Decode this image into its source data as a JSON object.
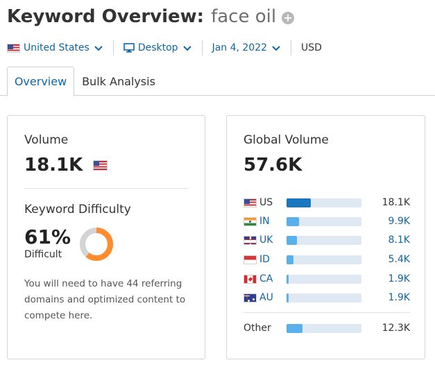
{
  "header": {
    "title": "Keyword Overview:",
    "keyword": "face oil"
  },
  "filters": {
    "country": "United States",
    "device": "Desktop",
    "date": "Jan 4, 2022",
    "currency": "USD"
  },
  "tabs": [
    {
      "label": "Overview",
      "active": true
    },
    {
      "label": "Bulk Analysis",
      "active": false
    }
  ],
  "volume": {
    "label": "Volume",
    "value": "18.1K"
  },
  "difficulty": {
    "label": "Keyword Difficulty",
    "percent": "61%",
    "percent_value": 61,
    "level": "Difficult",
    "description": "You will need to have 44 referring domains and optimized content to compete here.",
    "colors": {
      "fill": "#ff8c2e",
      "track": "#d4d4d4"
    }
  },
  "global_volume": {
    "label": "Global Volume",
    "value": "57.6K",
    "countries": [
      {
        "code": "US",
        "value": "18.1K",
        "share": 0.32,
        "flag": "us-flag-icon"
      },
      {
        "code": "IN",
        "value": "9.9K",
        "share": 0.17,
        "flag": "india-flag-icon"
      },
      {
        "code": "UK",
        "value": "8.1K",
        "share": 0.14,
        "flag": "uk-flag-icon"
      },
      {
        "code": "ID",
        "value": "5.4K",
        "share": 0.09,
        "flag": "indonesia-flag-icon"
      },
      {
        "code": "CA",
        "value": "1.9K",
        "share": 0.03,
        "flag": "canada-flag-icon"
      },
      {
        "code": "AU",
        "value": "1.9K",
        "share": 0.03,
        "flag": "australia-flag-icon"
      }
    ],
    "other": {
      "label": "Other",
      "value": "12.3K",
      "share": 0.21
    }
  }
}
